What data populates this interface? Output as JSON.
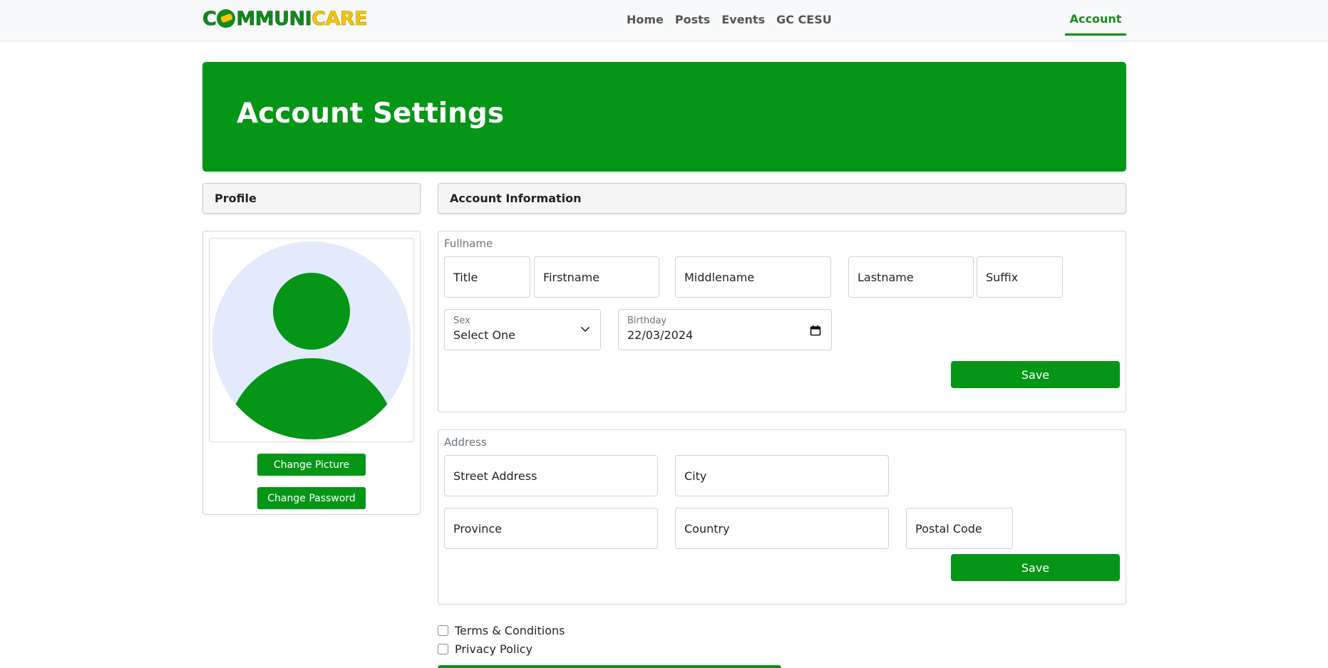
{
  "brand": {
    "name_a": "C",
    "name_b": "MMUNI",
    "name_c": "CARE"
  },
  "nav": {
    "links": [
      "Home",
      "Posts",
      "Events",
      "GC CESU"
    ],
    "account": "Account"
  },
  "hero": {
    "title": "Account Settings"
  },
  "profile": {
    "header": "Profile",
    "change_picture": "Change Picture",
    "change_password": "Change Password"
  },
  "account_info": {
    "header": "Account Information",
    "fullname": {
      "legend": "Fullname",
      "title_ph": "Title",
      "firstname_ph": "Firstname",
      "middlename_ph": "Middlename",
      "lastname_ph": "Lastname",
      "suffix_ph": "Suffix",
      "sex_label": "Sex",
      "sex_value": "Select One",
      "birthday_label": "Birthday",
      "birthday_value": "22/03/2024",
      "save": "Save"
    },
    "address": {
      "legend": "Address",
      "street_ph": "Street Address",
      "city_ph": "City",
      "province_ph": "Province",
      "country_ph": "Country",
      "postal_ph": "Postal Code",
      "save": "Save"
    }
  },
  "agreements": {
    "terms": "Terms & Conditions",
    "privacy": "Privacy Policy"
  },
  "colors": {
    "brand_green": "#059517",
    "brand_yellow": "#f5c400",
    "avatar_bg": "#e3eafc"
  },
  "icons": {
    "sex_select": "chevron-down-icon",
    "birthday": "calendar-icon"
  }
}
